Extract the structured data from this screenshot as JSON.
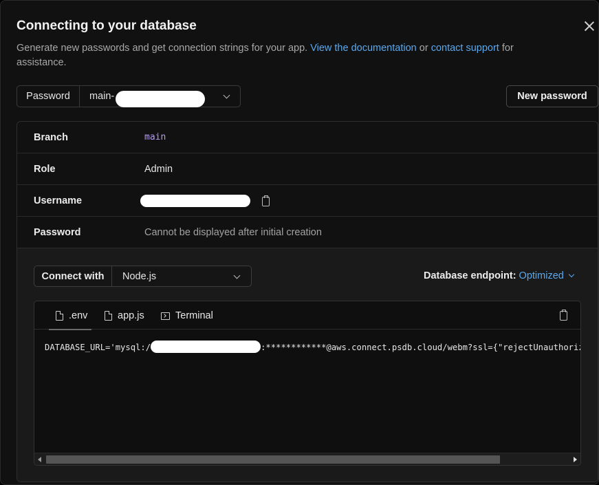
{
  "dialog": {
    "title": "Connecting to your database",
    "description_prefix": "Generate new passwords and get connection strings for your app.",
    "doc_link": "View the documentation",
    "or_text": "or",
    "support_link": "contact support",
    "description_suffix": "for assistance."
  },
  "password_select": {
    "label": "Password",
    "value": "main-"
  },
  "new_password_button": "New password",
  "details": [
    {
      "key": "Branch",
      "value": "main"
    },
    {
      "key": "Role",
      "value": "Admin"
    },
    {
      "key": "Username",
      "value": ""
    },
    {
      "key": "Password",
      "value": "Cannot be displayed after initial creation"
    }
  ],
  "connect_with": {
    "label": "Connect with",
    "value": "Node.js"
  },
  "endpoint": {
    "label": "Database endpoint:",
    "value": "Optimized"
  },
  "code_tabs": [
    {
      "label": ".env",
      "icon": "file-icon",
      "active": true
    },
    {
      "label": "app.js",
      "icon": "file-icon",
      "active": false
    },
    {
      "label": "Terminal",
      "icon": "terminal-icon",
      "active": false
    }
  ],
  "code": {
    "prefix": "DATABASE_URL='mysql:/",
    "suffix": ":************@aws.connect.psdb.cloud/webm?ssl={\"rejectUnauthorized\":true}'"
  },
  "colors": {
    "background": "#111111",
    "accent": "#5aa9ef",
    "branch_mono": "#b59cf5"
  }
}
